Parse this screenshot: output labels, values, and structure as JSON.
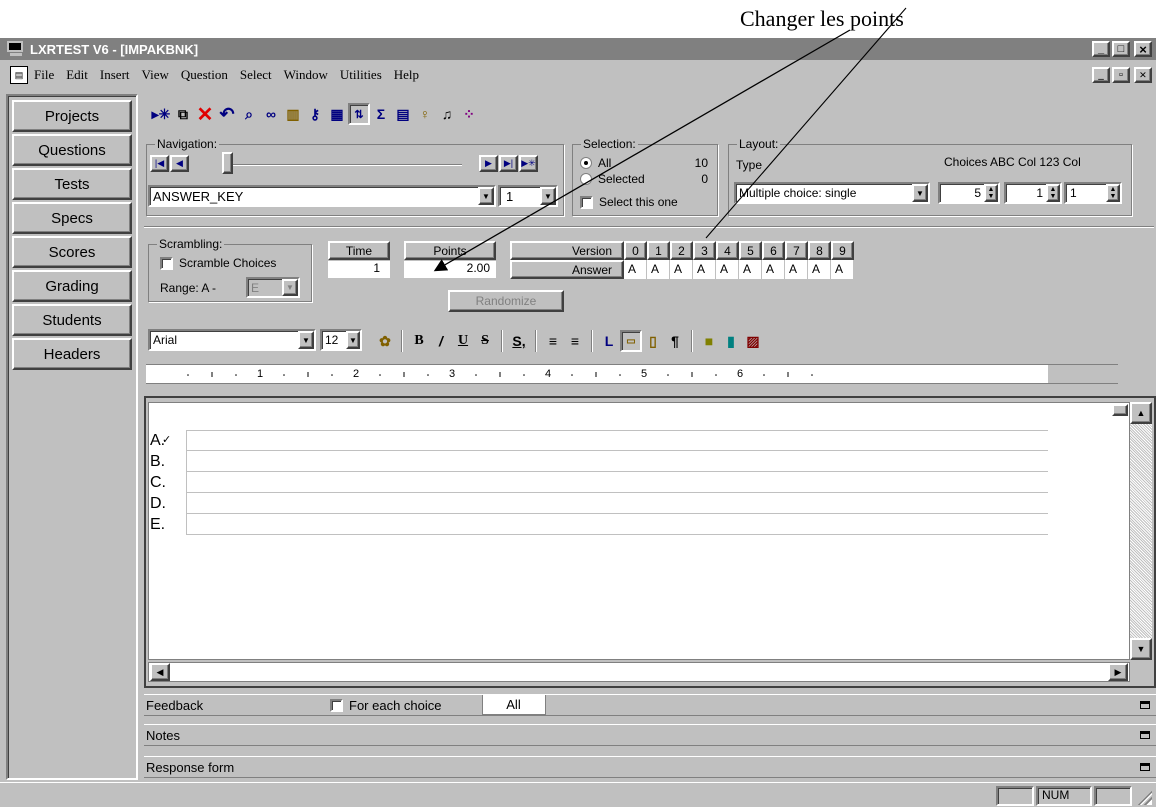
{
  "annotation": {
    "text": "Changer les points"
  },
  "titlebar": {
    "title": "LXRTEST V6 - [IMPAKBNK]",
    "min": "_",
    "max": "□",
    "close": "×"
  },
  "menu": {
    "items": [
      "File",
      "Edit",
      "Insert",
      "View",
      "Question",
      "Select",
      "Window",
      "Utilities",
      "Help"
    ],
    "min": "_",
    "restore": "▫",
    "close": "×"
  },
  "sidebar": {
    "items": [
      "Projects",
      "Questions",
      "Tests",
      "Specs",
      "Scores",
      "Grading",
      "Students",
      "Headers"
    ]
  },
  "navigation": {
    "label": "Navigation:",
    "key_value": "ANSWER_KEY",
    "index_value": "1"
  },
  "selection": {
    "label": "Selection:",
    "all": "All",
    "all_count": "10",
    "selected": "Selected",
    "selected_count": "0",
    "select_this": "Select this one"
  },
  "layout": {
    "label": "Layout:",
    "type_label": "Type",
    "choices_label": "Choices ABC Col 123 Col",
    "type_value": "Multiple choice: single",
    "choices": "5",
    "abc_col": "1",
    "num_col": "1"
  },
  "scrambling": {
    "label": "Scrambling:",
    "scramble": "Scramble Choices",
    "range_label": "Range: A -",
    "range_value": "E"
  },
  "time": {
    "label": "Time",
    "value": "1"
  },
  "points": {
    "label": "Points",
    "value": "2.00"
  },
  "randomize": {
    "label": "Randomize"
  },
  "version_table": {
    "row1_label": "Version",
    "row2_label": "Answer",
    "versions": [
      "0",
      "1",
      "2",
      "3",
      "4",
      "5",
      "6",
      "7",
      "8",
      "9"
    ],
    "answers": [
      "A",
      "A",
      "A",
      "A",
      "A",
      "A",
      "A",
      "A",
      "A",
      "A"
    ]
  },
  "format": {
    "font": "Arial",
    "size": "12"
  },
  "ruler": {
    "ticks": [
      "1",
      "2",
      "3",
      "4",
      "5",
      "6"
    ]
  },
  "choices": [
    {
      "label": "A.",
      "check": "✓"
    },
    {
      "label": "B."
    },
    {
      "label": "C."
    },
    {
      "label": "D."
    },
    {
      "label": "E."
    }
  ],
  "panels": {
    "feedback": "Feedback",
    "for_each_choice": "For each choice",
    "all_tab": "All",
    "notes": "Notes",
    "response_form": "Response form"
  },
  "status": {
    "num": "NUM"
  }
}
